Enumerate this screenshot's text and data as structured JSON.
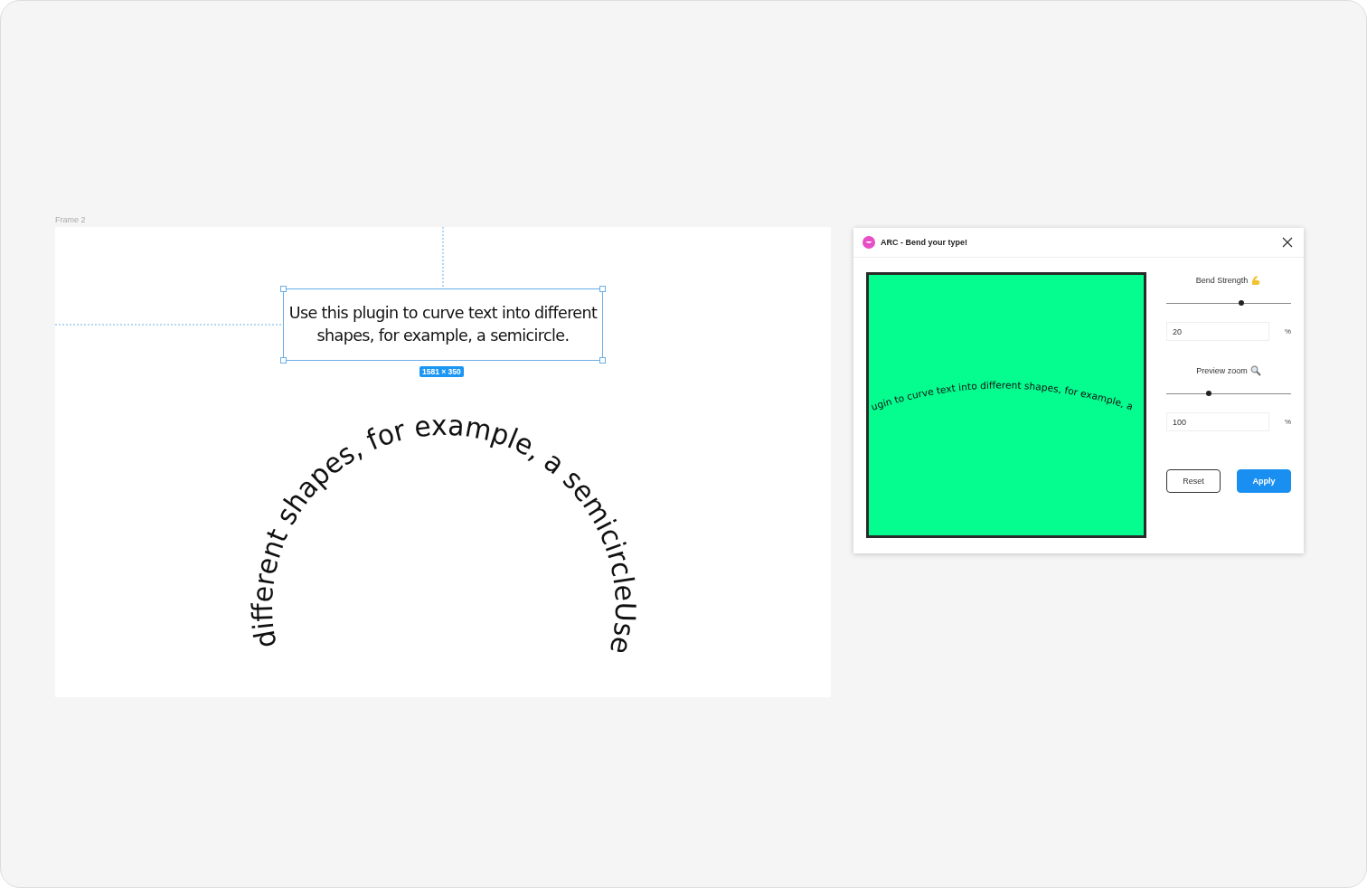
{
  "canvas": {
    "frame_label": "Frame 2",
    "selected_text": "Use this plugin to curve text into different shapes, for example, a semicircle.",
    "size_badge": "1581 × 350",
    "curved_text": "different shapes, for example, a semicircleUse"
  },
  "plugin": {
    "title": "ARC - Bend your type!",
    "preview_text": "ugin to curve text into different shapes, for example, a",
    "controls": [
      {
        "label": "Bend Strength",
        "level": 0.6,
        "value": "20",
        "unit": "%"
      },
      {
        "label": "Preview zoom",
        "level": 0.34,
        "value": "100",
        "unit": "%"
      }
    ],
    "buttons": [
      {
        "label": "Reset",
        "kind": "secondary"
      },
      {
        "label": "Apply",
        "kind": "primary"
      }
    ]
  }
}
